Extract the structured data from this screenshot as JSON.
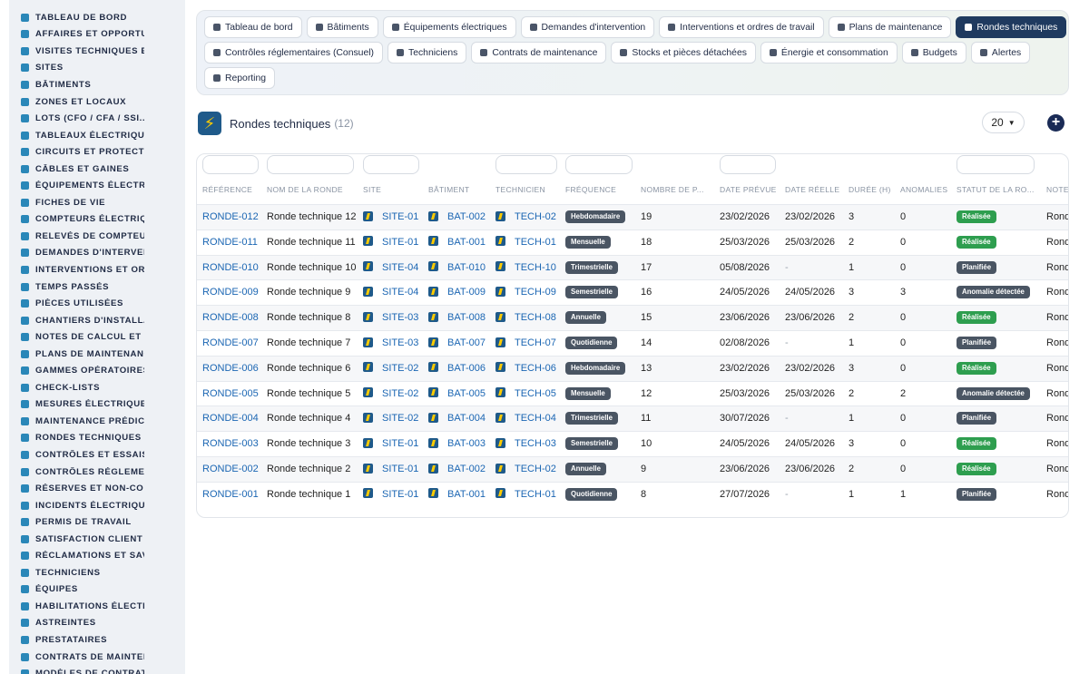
{
  "sidebar": {
    "items": [
      "TABLEAU DE BORD",
      "AFFAIRES ET OPPORTUNITÉS",
      "VISITES TECHNIQUES ET",
      "SITES",
      "BÂTIMENTS",
      "ZONES ET LOCAUX",
      "LOTS (CFO / CFA / SSI...)",
      "TABLEAUX ÉLECTRIQUES",
      "CIRCUITS ET PROTECTIONS",
      "CÂBLES ET GAINES",
      "ÉQUIPEMENTS ÉLECTRIQUES",
      "FICHES DE VIE",
      "COMPTEURS ÉLECTRIQUES",
      "RELEVÉS DE COMPTEURS",
      "DEMANDES D'INTERVENTION",
      "INTERVENTIONS ET ORDRES",
      "TEMPS PASSÉS",
      "PIÈCES UTILISÉES",
      "CHANTIERS D'INSTALLATION",
      "NOTES DE CALCUL ET ÉTUDES",
      "PLANS DE MAINTENANCE",
      "GAMMES OPÉRATOIRES",
      "CHECK-LISTS",
      "MESURES ÉLECTRIQUES",
      "MAINTENANCE PRÉDICTIVE",
      "RONDES TECHNIQUES",
      "CONTRÔLES ET ESSAIS",
      "CONTRÔLES RÉGLEMENTAIRES",
      "RÉSERVES ET NON-CONFORMITÉS",
      "INCIDENTS ÉLECTRIQUES",
      "PERMIS DE TRAVAIL",
      "SATISFACTION CLIENT",
      "RÉCLAMATIONS ET SAV",
      "TECHNICIENS",
      "ÉQUIPES",
      "HABILITATIONS ÉLECTRIQUES",
      "ASTREINTES",
      "PRESTATAIRES",
      "CONTRATS DE MAINTENANCE",
      "MODÈLES DE CONTRATS"
    ]
  },
  "nav": {
    "row1": [
      "Tableau de bord",
      "Bâtiments",
      "Équipements électriques",
      "Demandes d'intervention",
      "Interventions et ordres de travail",
      "Plans de maintenance",
      "Rondes techniques"
    ],
    "row2": [
      "Contrôles réglementaires (Consuel)",
      "Techniciens",
      "Contrats de maintenance",
      "Stocks et pièces détachées",
      "Énergie et consommation",
      "Budgets",
      "Alertes"
    ],
    "row3": [
      "Reporting"
    ],
    "active": "Rondes techniques"
  },
  "header": {
    "title": "Rondes techniques",
    "count": "(12)",
    "page_size": "20",
    "add_icon": "plus-circle-icon"
  },
  "columns": [
    "RÉFÉRENCE",
    "NOM DE LA RONDE",
    "SITE",
    "BÂTIMENT",
    "TECHNICIEN",
    "FRÉQUENCE",
    "NOMBRE DE P...",
    "DATE PRÉVUE",
    "DATE RÉELLE",
    "DURÉE (H)",
    "ANOMALIES",
    "STATUT DE LA RO...",
    "NOTE"
  ],
  "status_colors": {
    "Réalisée": "#2e9e4f",
    "Planifiée": "#4a5563",
    "Anomalie détectée": "#4a5563"
  },
  "rows": [
    {
      "ref": "RONDE-012",
      "name": "Ronde technique 12",
      "site": "SITE-01",
      "bat": "BAT-002",
      "tech": "TECH-02",
      "freq": "Hebdomadaire",
      "nb": "19",
      "prevue": "23/02/2026",
      "reelle": "23/02/2026",
      "duree": "3",
      "anom": "0",
      "statut": "Réalisée",
      "note": "Ronde"
    },
    {
      "ref": "RONDE-011",
      "name": "Ronde technique 11",
      "site": "SITE-01",
      "bat": "BAT-001",
      "tech": "TECH-01",
      "freq": "Mensuelle",
      "nb": "18",
      "prevue": "25/03/2026",
      "reelle": "25/03/2026",
      "duree": "2",
      "anom": "0",
      "statut": "Réalisée",
      "note": "Ronde"
    },
    {
      "ref": "RONDE-010",
      "name": "Ronde technique 10",
      "site": "SITE-04",
      "bat": "BAT-010",
      "tech": "TECH-10",
      "freq": "Trimestrielle",
      "nb": "17",
      "prevue": "05/08/2026",
      "reelle": "-",
      "duree": "1",
      "anom": "0",
      "statut": "Planifiée",
      "note": "Ronde"
    },
    {
      "ref": "RONDE-009",
      "name": "Ronde technique 9",
      "site": "SITE-04",
      "bat": "BAT-009",
      "tech": "TECH-09",
      "freq": "Semestrielle",
      "nb": "16",
      "prevue": "24/05/2026",
      "reelle": "24/05/2026",
      "duree": "3",
      "anom": "3",
      "statut": "Anomalie détectée",
      "note": "Ronde"
    },
    {
      "ref": "RONDE-008",
      "name": "Ronde technique 8",
      "site": "SITE-03",
      "bat": "BAT-008",
      "tech": "TECH-08",
      "freq": "Annuelle",
      "nb": "15",
      "prevue": "23/06/2026",
      "reelle": "23/06/2026",
      "duree": "2",
      "anom": "0",
      "statut": "Réalisée",
      "note": "Ronde"
    },
    {
      "ref": "RONDE-007",
      "name": "Ronde technique 7",
      "site": "SITE-03",
      "bat": "BAT-007",
      "tech": "TECH-07",
      "freq": "Quotidienne",
      "nb": "14",
      "prevue": "02/08/2026",
      "reelle": "-",
      "duree": "1",
      "anom": "0",
      "statut": "Planifiée",
      "note": "Ronde"
    },
    {
      "ref": "RONDE-006",
      "name": "Ronde technique 6",
      "site": "SITE-02",
      "bat": "BAT-006",
      "tech": "TECH-06",
      "freq": "Hebdomadaire",
      "nb": "13",
      "prevue": "23/02/2026",
      "reelle": "23/02/2026",
      "duree": "3",
      "anom": "0",
      "statut": "Réalisée",
      "note": "Ronde"
    },
    {
      "ref": "RONDE-005",
      "name": "Ronde technique 5",
      "site": "SITE-02",
      "bat": "BAT-005",
      "tech": "TECH-05",
      "freq": "Mensuelle",
      "nb": "12",
      "prevue": "25/03/2026",
      "reelle": "25/03/2026",
      "duree": "2",
      "anom": "2",
      "statut": "Anomalie détectée",
      "note": "Ronde"
    },
    {
      "ref": "RONDE-004",
      "name": "Ronde technique 4",
      "site": "SITE-02",
      "bat": "BAT-004",
      "tech": "TECH-04",
      "freq": "Trimestrielle",
      "nb": "11",
      "prevue": "30/07/2026",
      "reelle": "-",
      "duree": "1",
      "anom": "0",
      "statut": "Planifiée",
      "note": "Ronde"
    },
    {
      "ref": "RONDE-003",
      "name": "Ronde technique 3",
      "site": "SITE-01",
      "bat": "BAT-003",
      "tech": "TECH-03",
      "freq": "Semestrielle",
      "nb": "10",
      "prevue": "24/05/2026",
      "reelle": "24/05/2026",
      "duree": "3",
      "anom": "0",
      "statut": "Réalisée",
      "note": "Ronde"
    },
    {
      "ref": "RONDE-002",
      "name": "Ronde technique 2",
      "site": "SITE-01",
      "bat": "BAT-002",
      "tech": "TECH-02",
      "freq": "Annuelle",
      "nb": "9",
      "prevue": "23/06/2026",
      "reelle": "23/06/2026",
      "duree": "2",
      "anom": "0",
      "statut": "Réalisée",
      "note": "Ronde"
    },
    {
      "ref": "RONDE-001",
      "name": "Ronde technique 1",
      "site": "SITE-01",
      "bat": "BAT-001",
      "tech": "TECH-01",
      "freq": "Quotidienne",
      "nb": "8",
      "prevue": "27/07/2026",
      "reelle": "-",
      "duree": "1",
      "anom": "1",
      "statut": "Planifiée",
      "note": "Ronde"
    }
  ]
}
